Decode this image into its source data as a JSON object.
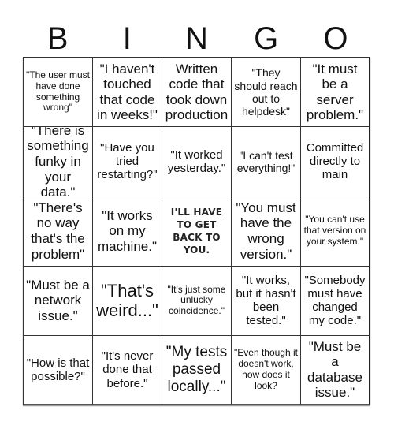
{
  "header": {
    "letters": [
      "B",
      "I",
      "N",
      "G",
      "O"
    ]
  },
  "board": {
    "cells": [
      [
        "\"The user must have done something wrong\"",
        "\"I haven't touched that code in weeks!\"",
        "Written code that took down production",
        "\"They should reach out to helpdesk\"",
        "\"It must be a server problem.\""
      ],
      [
        "\"There is something funky in your data.\"",
        "\"Have you tried restarting?\"",
        "\"It worked yesterday.\"",
        "\"I can't test everything!\"",
        "Committed directly to main"
      ],
      [
        "\"There's no way that's the problem\"",
        "\"It works on my machine.\"",
        "I'LL HAVE TO GET BACK TO YOU.",
        "\"You must have the wrong version.\"",
        "\"You can't use that version on your system.\""
      ],
      [
        "\"Must be a network issue.\"",
        "\"That's weird...\"",
        "\"It's just some unlucky coincidence.\"",
        "\"It works, but it hasn't been tested.\"",
        "\"Somebody must have changed my code.\""
      ],
      [
        "\"How is that possible?\"",
        "\"It's never done that before.\"",
        "\"My tests passed locally...\"",
        "\"Even though it doesn't work, how does it look?",
        "\"Must be a database issue.\""
      ]
    ],
    "free_space": {
      "row": 2,
      "col": 2,
      "image": "free-space-image",
      "text": "I'LL HAVE TO GET BACK TO YOU."
    }
  }
}
